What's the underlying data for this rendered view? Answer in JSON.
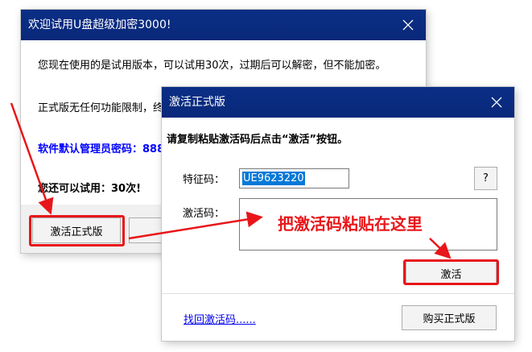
{
  "trial_window": {
    "title": "欢迎试用U盘超级加密3000!",
    "line1": "您现在使用的是试用版本，可以试用30次，过期后可以解密，但不能加密。",
    "line2": "正式版无任何功能限制，终",
    "admin_password_label": "软件默认管理员密码：888",
    "trial_remaining": "您还可以试用：30次!",
    "activate_button": "激活正式版"
  },
  "activate_window": {
    "title": "激活正式版",
    "instruction": "请复制粘贴激活码后点击“激活”按钮。",
    "feature_code_label": "特征码：",
    "feature_code_value": "UE9623220",
    "help_button": "?",
    "activation_code_label": "激活码：",
    "activation_code_value": "",
    "annotation": "把激活码粘贴在这里",
    "activate_button": "激活",
    "retrieve_link": "找回激活码......",
    "buy_button": "购买正式版"
  },
  "colors": {
    "titlebar": "#0b2f86",
    "accent_blue": "#0000ff",
    "annotation_red": "#e8161a",
    "selection": "#0078d7"
  }
}
